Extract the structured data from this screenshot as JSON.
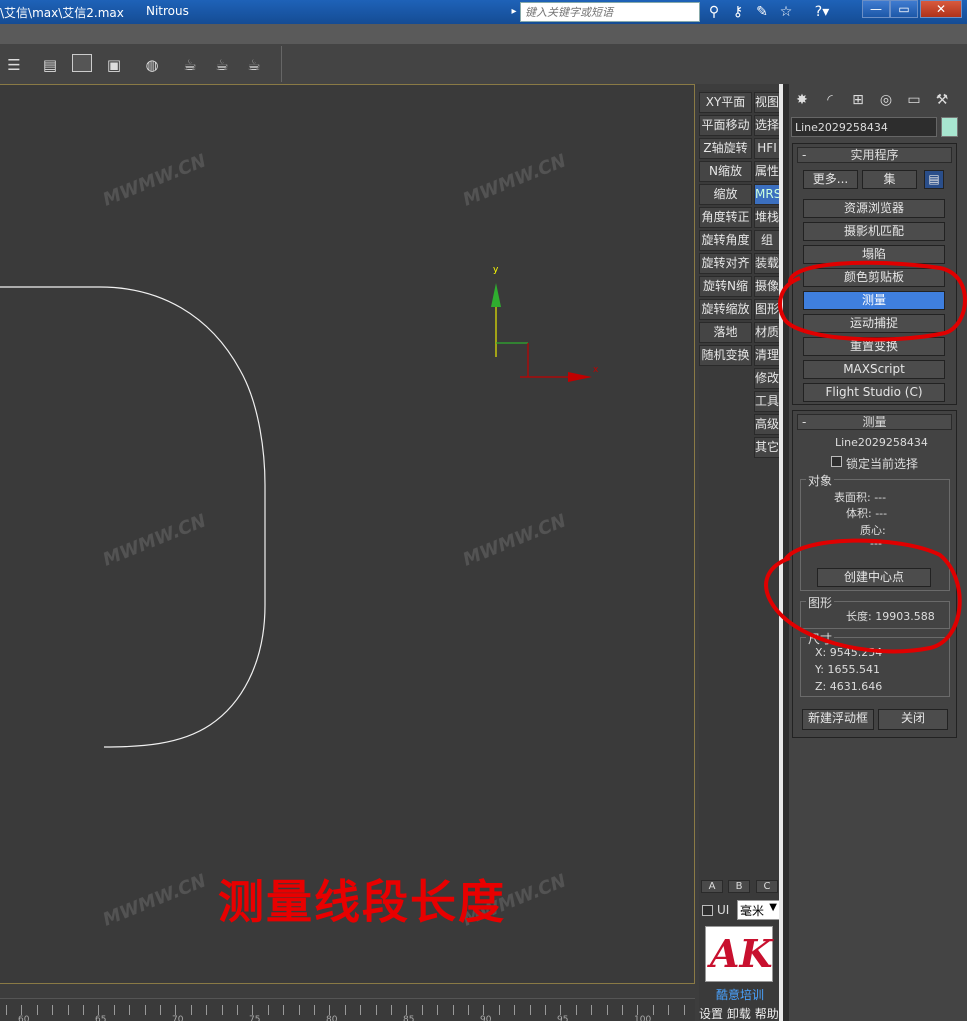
{
  "window": {
    "title": "\\艾信\\max\\艾信2.max",
    "renderer": "Nitrous",
    "search_placeholder": "键入关键字或短语",
    "search_arrow": "▸",
    "minimize": "—",
    "restore": "▭",
    "close": "✕"
  },
  "viewport": {
    "axis_y_label": "y",
    "axis_x_label": "x",
    "ruler_labels": [
      "60",
      "65",
      "70",
      "75",
      "80",
      "85",
      "90",
      "95",
      "100"
    ]
  },
  "quad_menu": {
    "left_items": [
      "XY平面",
      "平面移动",
      "Z轴旋转",
      "N缩放",
      "缩放",
      "角度转正",
      "旋转角度",
      "旋转对齐",
      "旋转N缩",
      "旋转缩放",
      "落地",
      "随机变换"
    ],
    "right_items": [
      "视图",
      "选择",
      "HFI",
      "属性",
      "MRS",
      "堆栈",
      "组",
      "装载",
      "摄像",
      "图形",
      "材质",
      "清理",
      "修改",
      "工具",
      "高级",
      "其它"
    ],
    "right_selected": "MRS",
    "tabs": [
      "A",
      "B",
      "C"
    ],
    "ui_label": "UI",
    "unit": "毫米",
    "logo_text": "AK",
    "logo_caption": "酷意培训",
    "bottom_menu": [
      "设置",
      "卸载",
      "帮助"
    ]
  },
  "command_panel": {
    "object_name": "Line2029258434",
    "swatch_color": "#a8e6d0",
    "utilities": {
      "header": "实用程序",
      "more": "更多...",
      "sets": "集",
      "buttons": [
        "资源浏览器",
        "摄影机匹配",
        "塌陷",
        "颜色剪贴板",
        "测量",
        "运动捕捉",
        "重置变换",
        "MAXScript",
        "Flight Studio (C)"
      ],
      "selected": "测量"
    },
    "measure": {
      "header": "测量",
      "object_name": "Line2029258434",
      "lock_label": "锁定当前选择",
      "object_group": "对象",
      "surface_area": "表面积: ---",
      "volume": "体积: ---",
      "centroid": "质心:",
      "centroid_value": "---",
      "create_center": "创建中心点",
      "shape_group": "图形",
      "length": "长度: 19903.588",
      "dimensions_group": "尺寸",
      "x": "X:   9545.254",
      "y": "Y:   1655.541",
      "z": "Z:   4631.646",
      "new_float": "新建浮动框",
      "close": "关闭"
    }
  },
  "annotation": {
    "text": "测量线段长度",
    "color": "#e80000"
  },
  "watermark": "MWMW.CN"
}
